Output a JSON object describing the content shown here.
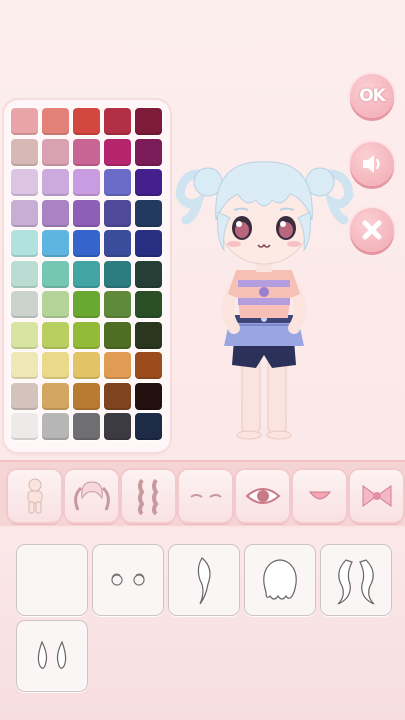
{
  "buttons": {
    "ok_label": "OK",
    "sound_icon": "speaker-icon",
    "close_icon": "close-x-icon"
  },
  "palette": {
    "colors": [
      "#e8a4a6",
      "#e38279",
      "#d2473f",
      "#b32f46",
      "#7e1b3a",
      "#d8b8b4",
      "#d9a2b2",
      "#c96594",
      "#b5256e",
      "#7b1c58",
      "#dcc4e5",
      "#ccaadd",
      "#c99be0",
      "#6a6cc8",
      "#44208d",
      "#c6aed4",
      "#a983c4",
      "#8f5fb8",
      "#4e4a99",
      "#23395d",
      "#b1e2dd",
      "#5eb5df",
      "#3565cc",
      "#3a4d9c",
      "#282e82",
      "#b9ddd2",
      "#76c7b2",
      "#42a4a3",
      "#2c7c80",
      "#253e36",
      "#cbd3cf",
      "#b4d49a",
      "#69a931",
      "#5f8a3c",
      "#2a4f27",
      "#d9e3a2",
      "#b9d060",
      "#94bb38",
      "#4f6e24",
      "#2a361e",
      "#f0e7b7",
      "#ebd98a",
      "#e2c365",
      "#e09b54",
      "#9c4c1c",
      "#d4c3bd",
      "#d3a662",
      "#b97a31",
      "#7e4420",
      "#22100f",
      "#ecebea",
      "#b6b6b6",
      "#6f6e72",
      "#3c3b42",
      "#1d2b46"
    ]
  },
  "categories": [
    "body",
    "hair-twintails",
    "hair-braids",
    "eyebrows",
    "eyes",
    "mouth",
    "hair-bow"
  ],
  "items": [
    "none",
    "eyes-round",
    "side-lock-hair",
    "bob-hair",
    "long-side-hair",
    "ears-pointed"
  ]
}
